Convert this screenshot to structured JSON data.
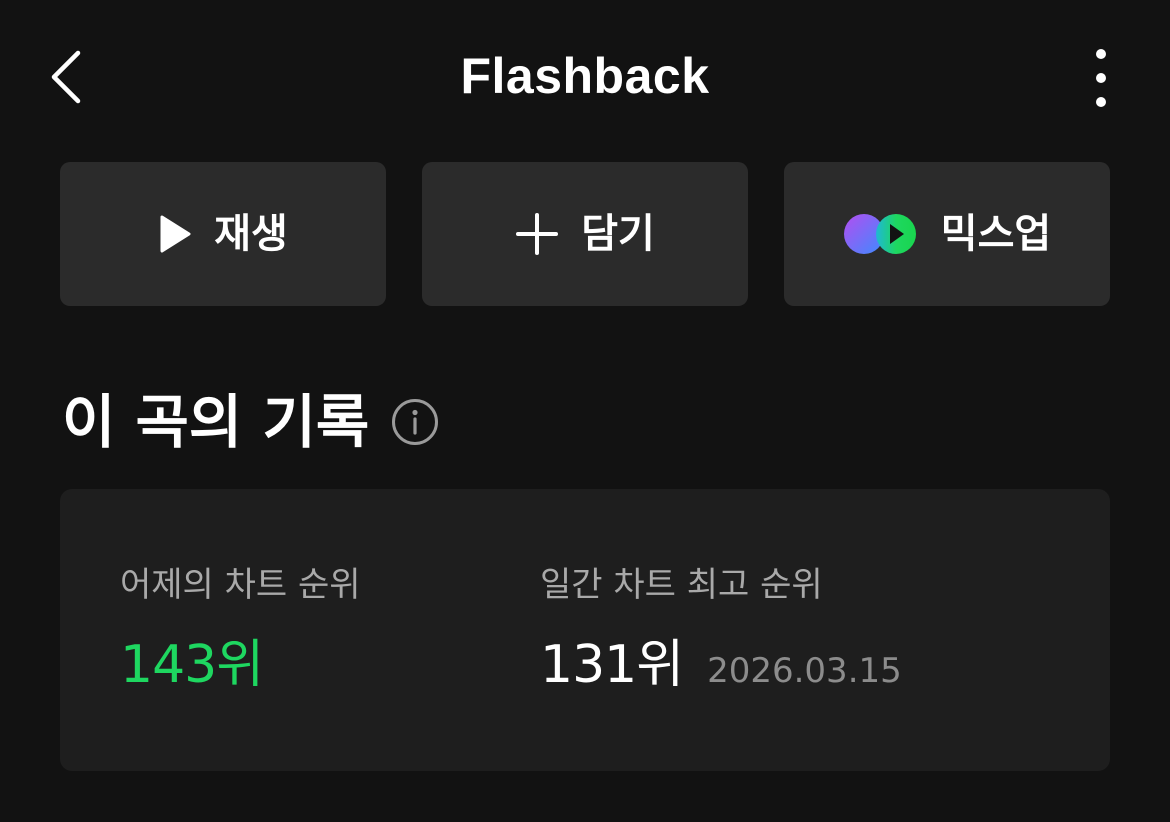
{
  "header": {
    "title": "Flashback",
    "back_icon": "chevron-left-icon",
    "more_icon": "more-vertical-icon"
  },
  "actions": {
    "play_label": "재생",
    "add_label": "담기",
    "mixup_label": "믹스업"
  },
  "section": {
    "title": "이 곡의 기록",
    "info_icon": "info-icon"
  },
  "record": {
    "yesterday_label": "어제의 차트 순위",
    "yesterday_value": "143위",
    "best_label": "일간 차트 최고 순위",
    "best_value": "131위",
    "best_date": "2026.03.15"
  },
  "colors": {
    "background": "#121212",
    "button_bg": "#2b2b2b",
    "card_bg": "#1e1e1e",
    "accent_green": "#1ed760",
    "label_gray": "#a9a9a9"
  }
}
